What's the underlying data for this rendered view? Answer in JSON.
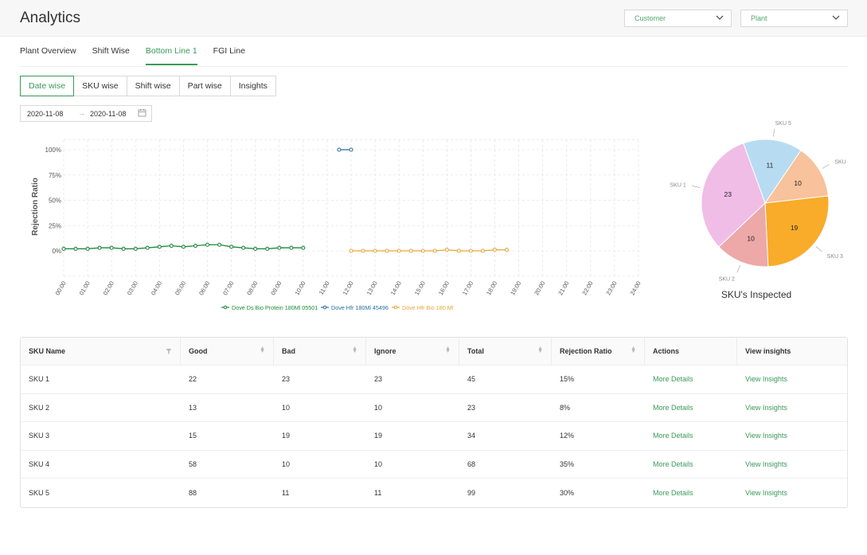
{
  "app": {
    "title": "Analytics"
  },
  "filters": {
    "customer": "Customer",
    "plant": "Plant"
  },
  "tabs": [
    "Plant Overview",
    "Shift Wise",
    "Bottom Line 1",
    "FGI Line"
  ],
  "active_tab": 2,
  "segments": [
    "Date wise",
    "SKU wise",
    "Shift wise",
    "Part wise",
    "Insights"
  ],
  "active_segment": 0,
  "date_range": {
    "start": "2020-11-08",
    "end": "2020-11-08"
  },
  "colors": {
    "accent": "#3a9a58",
    "series1": "#1e8a3c",
    "series2": "#2a6fa0",
    "series3": "#e8a63a"
  },
  "chart_data": [
    {
      "type": "line",
      "ylabel": "Rejection Ratio",
      "xlabel": "",
      "y_ticks": [
        "0%",
        "25%",
        "50%",
        "75%",
        "100%"
      ],
      "ylim": [
        0,
        100
      ],
      "x_ticks": [
        "00:00",
        "01:00",
        "02:00",
        "03:00",
        "04:00",
        "05:00",
        "06:00",
        "07:00",
        "08:00",
        "09:00",
        "10:00",
        "11:00",
        "12:00",
        "13:00",
        "14:00",
        "15:00",
        "16:00",
        "17:00",
        "18:00",
        "19:00",
        "20:00",
        "21:00",
        "22:00",
        "23:00",
        "24:00"
      ],
      "xlim": [
        0,
        24
      ],
      "grid": true,
      "legend": "bottom",
      "series": [
        {
          "name": "Dove Ds Bio Protein 180Ml 05501",
          "x": [
            0,
            0.5,
            1,
            1.5,
            2,
            2.5,
            3,
            3.5,
            4,
            4.5,
            5,
            5.5,
            6,
            6.5,
            7,
            7.5,
            8,
            8.5,
            9,
            9.5,
            10
          ],
          "y": [
            2,
            2,
            2,
            3,
            3,
            2,
            2,
            3,
            4,
            5,
            4,
            5,
            6,
            6,
            4,
            3,
            2,
            2,
            3,
            3,
            3
          ]
        },
        {
          "name": "Dove Hfr 180Ml 45496",
          "x": [
            11.5,
            12
          ],
          "y": [
            100,
            100
          ]
        },
        {
          "name": "Dove Hfr Bio 180 Ml",
          "x": [
            12,
            12.5,
            13,
            13.5,
            14,
            14.5,
            15,
            15.5,
            16,
            16.5,
            17,
            17.5,
            18,
            18.5
          ],
          "y": [
            0,
            0,
            0,
            0,
            0,
            0,
            0,
            0,
            1,
            0,
            0,
            0,
            1,
            1
          ]
        }
      ]
    },
    {
      "type": "pie",
      "title": "SKU's Inspected",
      "categories": [
        "SKU 1",
        "SKU 2",
        "SKU 3",
        "SKU 4",
        "SKU 5"
      ],
      "values": [
        23,
        10,
        19,
        10,
        11
      ],
      "colors": [
        "#f0bde6",
        "#eda8a8",
        "#f8ac2a",
        "#f7c29c",
        "#b7dcf2"
      ]
    }
  ],
  "table": {
    "columns": [
      "SKU Name",
      "Good",
      "Bad",
      "Ignore",
      "Total",
      "Rejection Ratio",
      "Actions",
      "View insights"
    ],
    "rows": [
      [
        "SKU 1",
        "22",
        "23",
        "23",
        "45",
        "15%",
        "More Details",
        "View Insights"
      ],
      [
        "SKU 2",
        "13",
        "10",
        "10",
        "23",
        "8%",
        "More Details",
        "View Insights"
      ],
      [
        "SKU 3",
        "15",
        "19",
        "19",
        "34",
        "12%",
        "More Details",
        "View Insights"
      ],
      [
        "SKU 4",
        "58",
        "10",
        "10",
        "68",
        "35%",
        "More Details",
        "View Insights"
      ],
      [
        "SKU 5",
        "88",
        "11",
        "11",
        "99",
        "30%",
        "More Details",
        "View Insights"
      ]
    ]
  }
}
